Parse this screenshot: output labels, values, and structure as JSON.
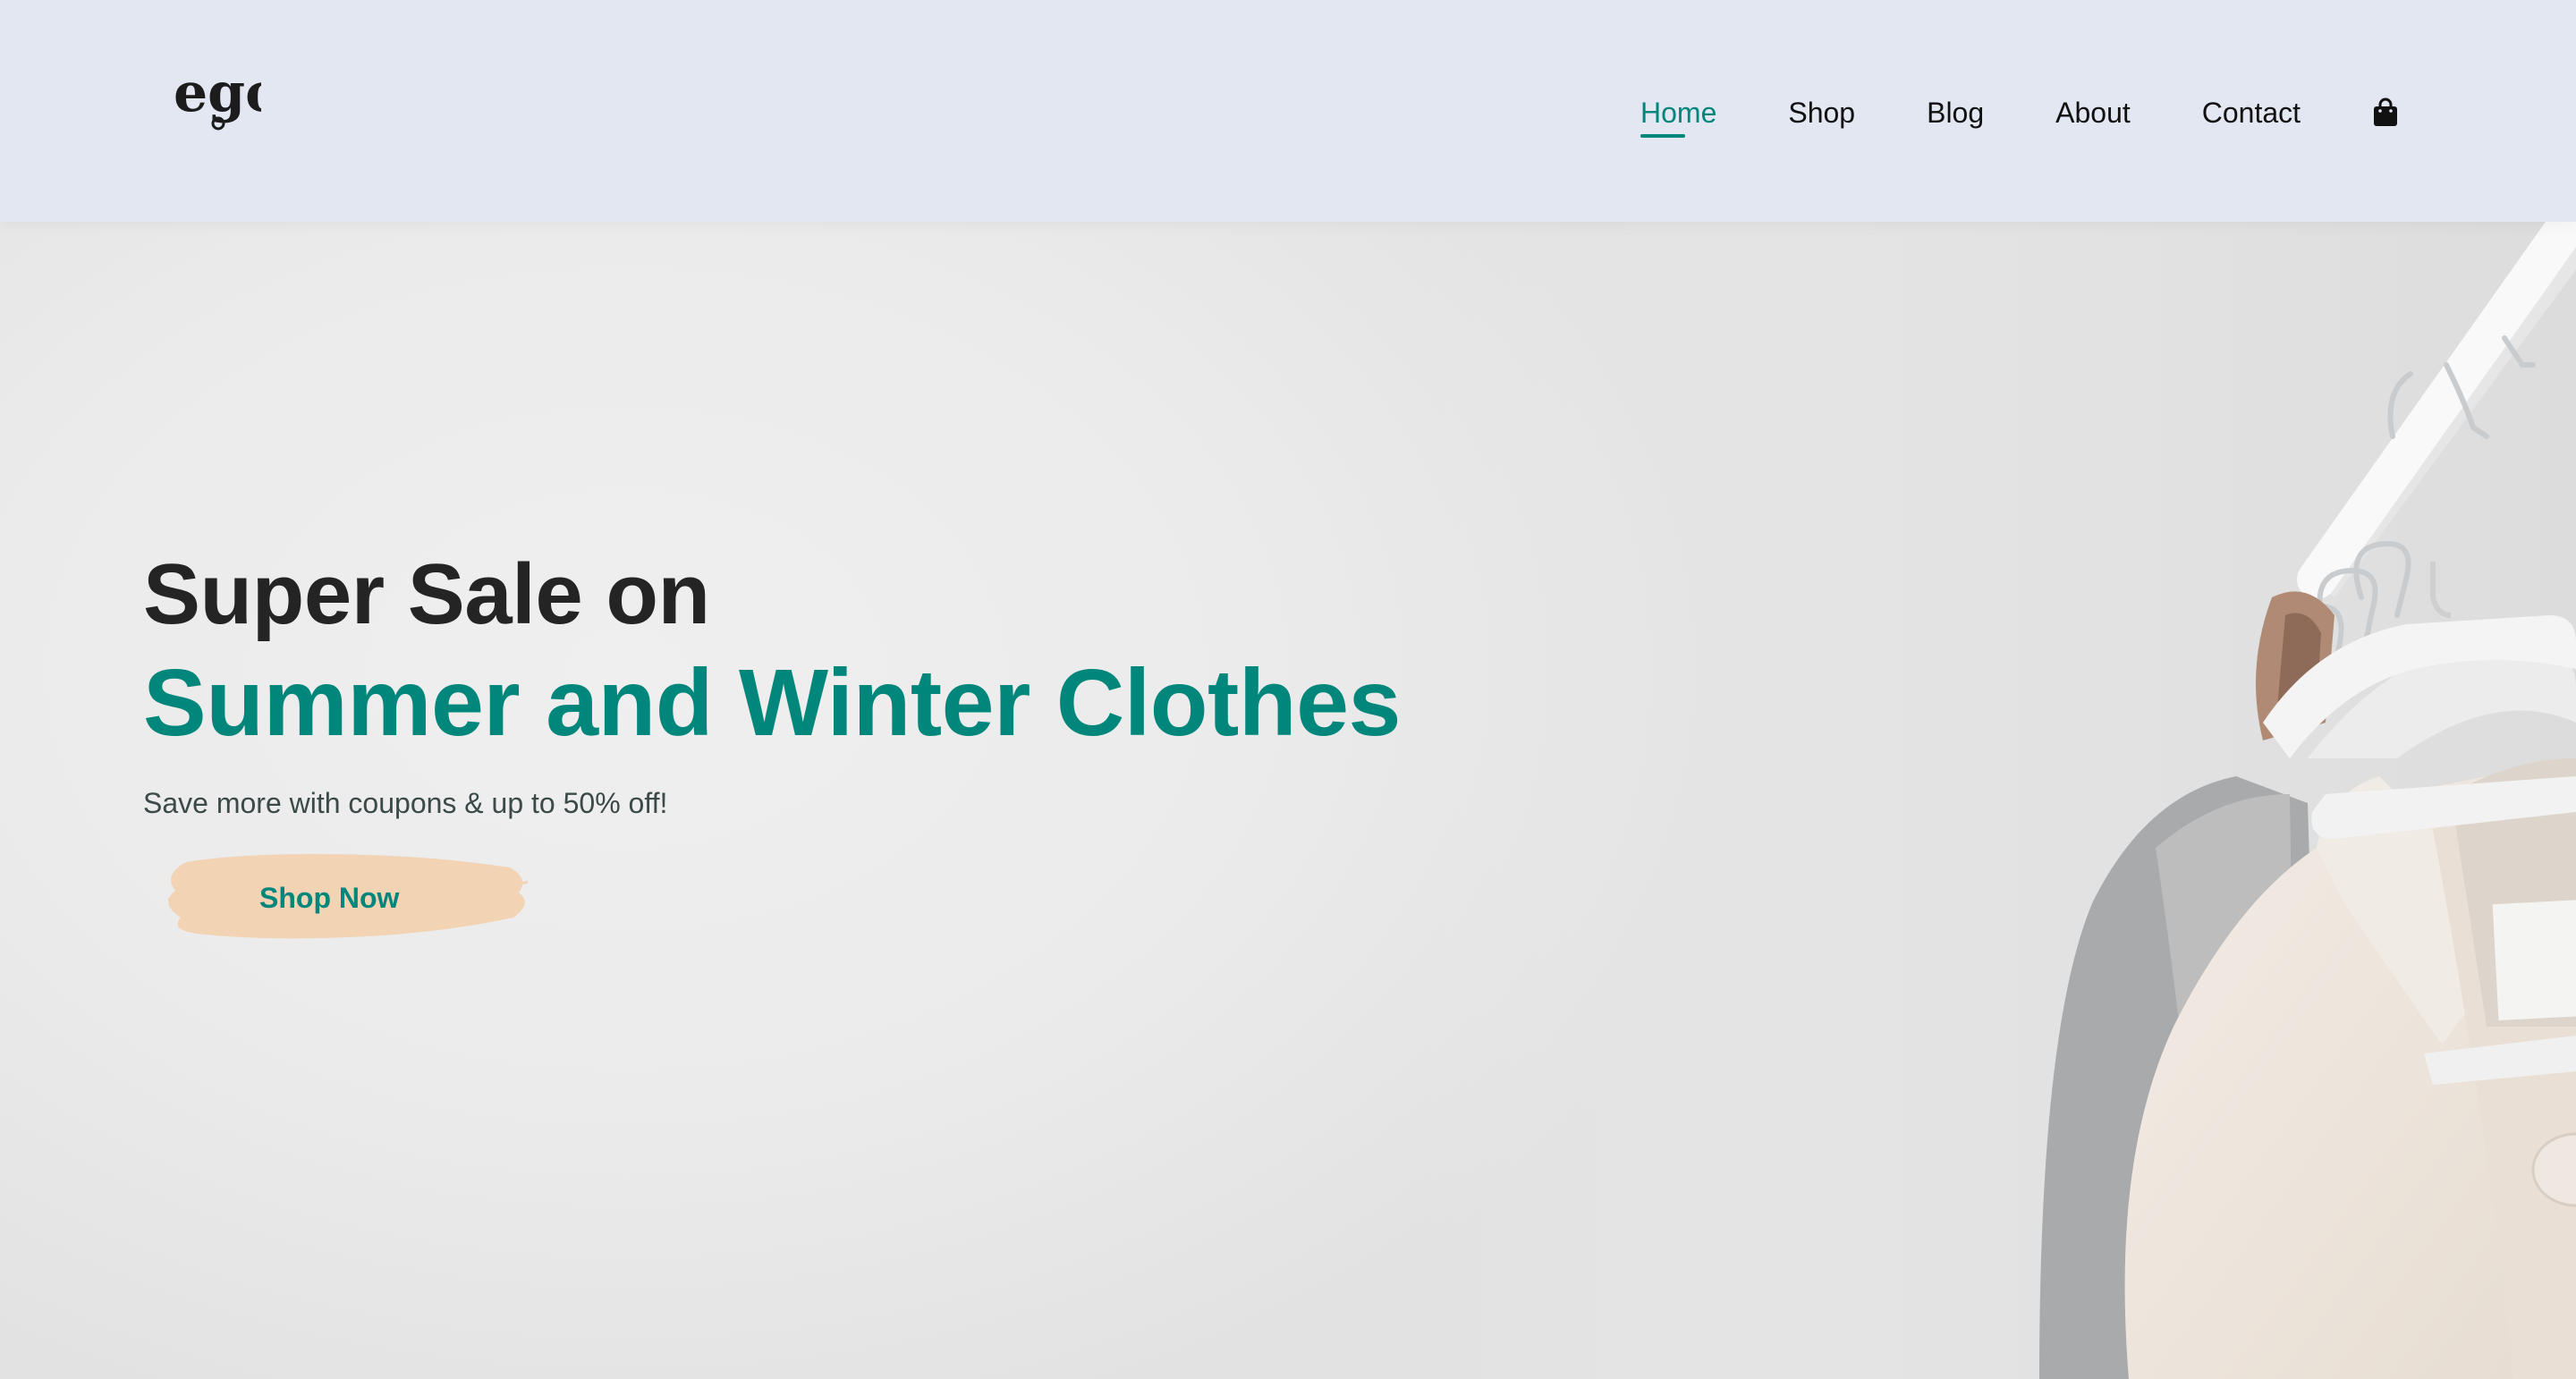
{
  "header": {
    "logo_text": "ego",
    "nav": [
      {
        "label": "Home",
        "active": true
      },
      {
        "label": "Shop",
        "active": false
      },
      {
        "label": "Blog",
        "active": false
      },
      {
        "label": "About",
        "active": false
      },
      {
        "label": "Contact",
        "active": false
      }
    ],
    "cart_icon": "shopping-bag-icon"
  },
  "hero": {
    "heading": "Super Sale on",
    "heading_accent": "Summer and Winter Clothes",
    "subtitle": "Save more with coupons & up to 50% off!",
    "cta_label": "Shop Now",
    "image": "clothes-on-hangers-photo"
  },
  "colors": {
    "accent": "#00867a",
    "header_bg": "#e3e7f2",
    "button_brush": "#f2d3b3",
    "heading": "#242424"
  }
}
